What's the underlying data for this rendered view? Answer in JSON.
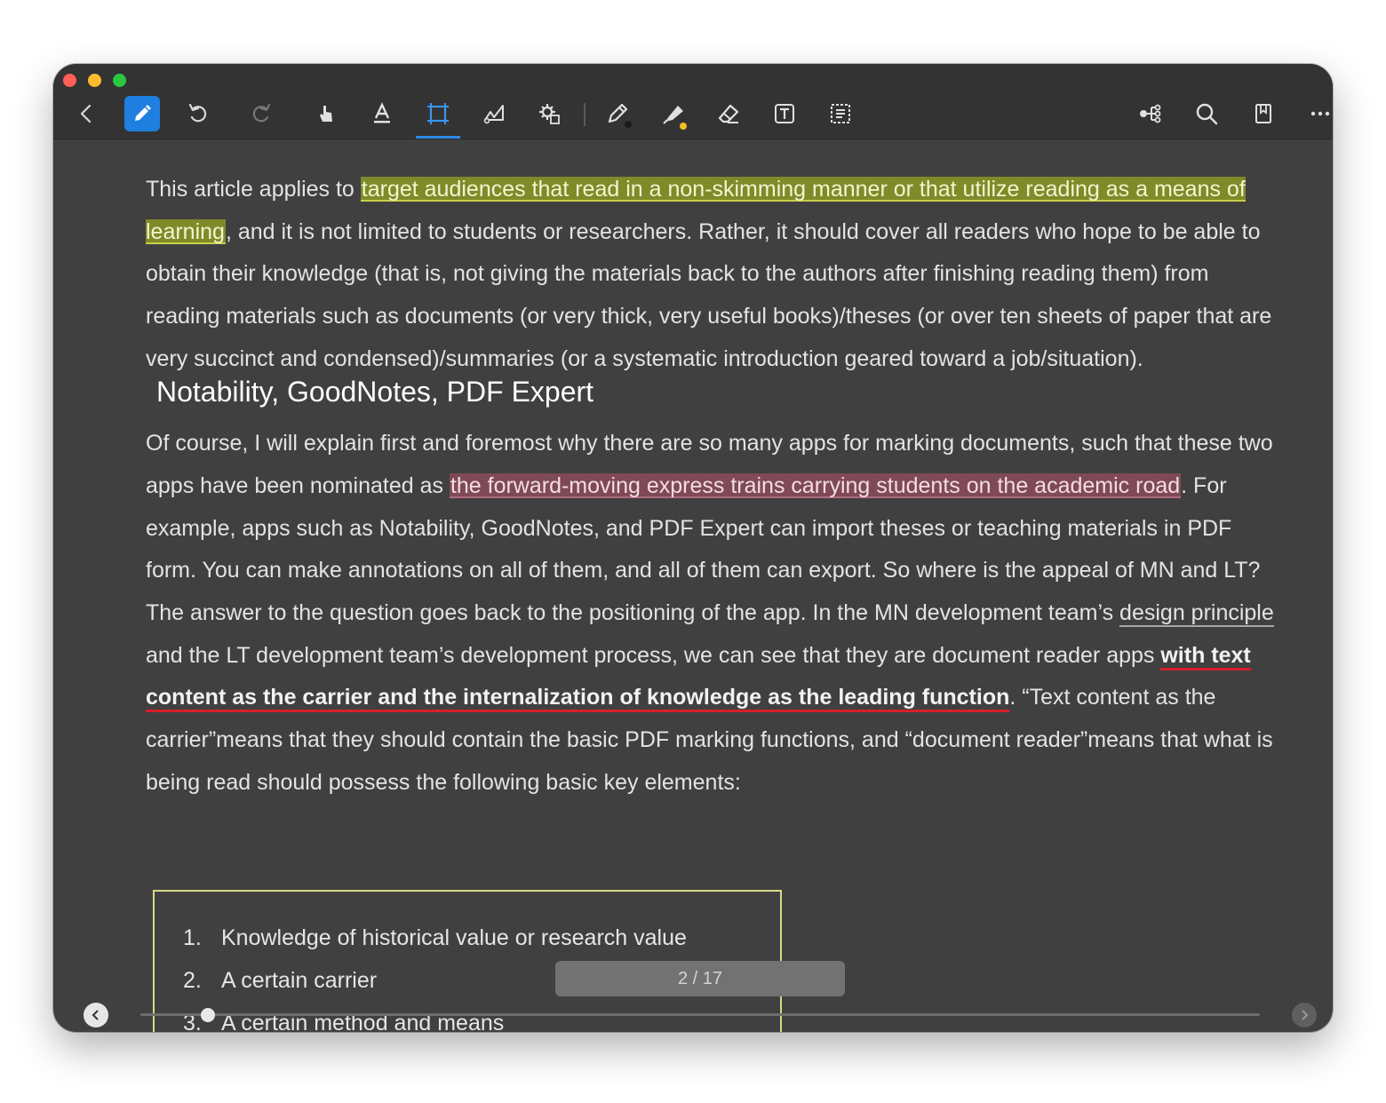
{
  "toolbar": {
    "icons": [
      "back-icon",
      "pen-mode-icon",
      "undo-icon",
      "redo-icon",
      "hand-icon",
      "text-select-icon",
      "rect-select-icon",
      "lasso-icon",
      "shape-settings-icon",
      "pen-icon",
      "highlighter-icon",
      "eraser-icon",
      "textbox-icon",
      "ocr-icon",
      "mindmap-icon",
      "search-icon",
      "bookmark-icon",
      "more-icon"
    ],
    "pen_dot_color": "#1a1a1a",
    "highlighter_dot_color": "#f2c01e",
    "accent": "#1f7fe0"
  },
  "content": {
    "p1": {
      "pre": "This article applies to ",
      "highlight": "target audiences that read in a non-skimming manner or that utilize reading as a means of learning",
      "post": ", and it is not limited to students or researchers. Rather, it should cover all readers who hope to be able to obtain their knowledge (that is, not giving the materials back to the authors after finishing reading them) from reading materials such as documents (or very thick, very useful books)/theses (or over ten sheets of paper that are very succinct and condensed)/summaries (or a systematic introduction geared toward a job/situation).",
      "note": "Notability, GoodNotes, PDF Expert"
    },
    "p2": {
      "s1": "Of course, I will explain first and foremost why there are so many apps for marking documents, such that these two apps have been nominated as ",
      "highlight": "the forward-moving express trains carrying students on the academic road",
      "s2": ". For example, apps such as Notability, GoodNotes, and PDF Expert can import theses or teaching materials in PDF form. You can make annotations on all of them, and all of them can export. So where is the appeal of MN and LT? The answer to the question goes back to the positioning of the app. In the MN development team’s ",
      "underline": "design principle",
      "s3": " and the LT development team’s development process, we can see that they are document reader apps ",
      "bold_underline": "with text content as the carrier and the internalization of knowledge as the leading function",
      "s4": ". “Text content as the carrier”means that they should contain the basic PDF marking functions, and “document reader”means that what is being read should possess the following basic key elements:"
    },
    "list": [
      {
        "num": "1.",
        "text": "Knowledge of historical value or research value"
      },
      {
        "num": "2.",
        "text": "A certain carrier"
      },
      {
        "num": "3.",
        "text": "A certain method and means"
      }
    ]
  },
  "footer": {
    "page_indicator": "2 / 17",
    "progress_fraction": 0.06
  }
}
